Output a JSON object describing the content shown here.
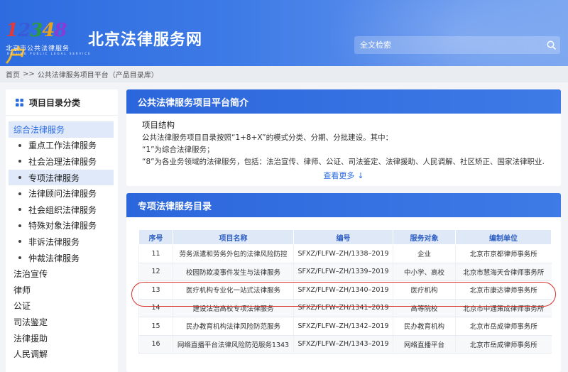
{
  "logo": {
    "number": [
      "1",
      "2",
      "3",
      "4",
      "8",
      "户"
    ],
    "cn": "北京市公共法律服务",
    "en": "BEIJING PUBLIC LEGAL SERVICE"
  },
  "header": {
    "title": "北京法律服务网"
  },
  "search": {
    "placeholder": "全文检索"
  },
  "breadcrumb": {
    "home": "首页",
    "sep": ">>",
    "current": "公共法律服务项目平台（产品目录库）"
  },
  "sidebar": {
    "title": "项目目录分类",
    "items": [
      {
        "label": "综合法律服务",
        "type": "active-cat"
      },
      {
        "label": "重点工作法律服务",
        "type": "sub"
      },
      {
        "label": "社会治理法律服务",
        "type": "sub"
      },
      {
        "label": "专项法律服务",
        "type": "sub-active"
      },
      {
        "label": "法律顾问法律服务",
        "type": "sub"
      },
      {
        "label": "社会组织法律服务",
        "type": "sub"
      },
      {
        "label": "特殊对象法律服务",
        "type": "sub"
      },
      {
        "label": "非诉法律服务",
        "type": "sub"
      },
      {
        "label": "仲裁法律服务",
        "type": "sub"
      },
      {
        "label": "法治宣传",
        "type": "cat"
      },
      {
        "label": "律师",
        "type": "cat"
      },
      {
        "label": "公证",
        "type": "cat"
      },
      {
        "label": "司法鉴定",
        "type": "cat"
      },
      {
        "label": "法律援助",
        "type": "cat"
      },
      {
        "label": "人民调解",
        "type": "cat"
      }
    ]
  },
  "intro": {
    "title": "公共法律服务项目平台简介",
    "subtitle": "项目结构",
    "lines": [
      "公共法律服务项目目录按照“1+8+X”的模式分类、分期、分批建设。其中：",
      "“1”为综合法律服务；",
      "“8”为各业务领域的法律服务，包括：法治宣传、律师、公证、司法鉴定、法律援助、人民调解、社区矫正、国家法律职业..."
    ],
    "more": "查看更多"
  },
  "catalog": {
    "title": "专项法律服务目录",
    "headers": [
      "序号",
      "项目名称",
      "编号",
      "服务对象",
      "编制单位"
    ],
    "rows": [
      [
        "11",
        "劳务派遣和劳务外包的法律风险防控",
        "SFXZ/FLFW–ZH/1338–2019",
        "企业",
        "北京市京都律师事务所"
      ],
      [
        "12",
        "校园防欺凌事件发生与法律服务",
        "SFXZ/FLFW–ZH/1339–2019",
        "中小学、高校",
        "北京市慧海天合律师事务所"
      ],
      [
        "13",
        "医疗机构专业化一站式法律服务",
        "SFXZ/FLFW–ZH/1340–2019",
        "医疗机构",
        "北京市康达律师事务所"
      ],
      [
        "14",
        "建设法治高校专项法律服务",
        "SFXZ/FLFW–ZH/1341–2019",
        "高等院校",
        "北京市中通策成律师事务所"
      ],
      [
        "15",
        "民办教育机构法律风险防范服务",
        "SFXZ/FLFW–ZH/1342–2019",
        "民办教育机构",
        "北京市岳成律师事务所"
      ],
      [
        "16",
        "网络直播平台法律风险防范服务1343",
        "SFXZ/FLFW–ZH/1343–2019",
        "网络直播平台",
        "北京市岳成律师事务所"
      ]
    ],
    "highlight_row": 2,
    "highlight_color": "#d9302a"
  },
  "colors": {
    "accent": "#2d6ce0",
    "header_light": "#7aa6f0",
    "sidebar_active_bg": "#dfe9fa"
  }
}
